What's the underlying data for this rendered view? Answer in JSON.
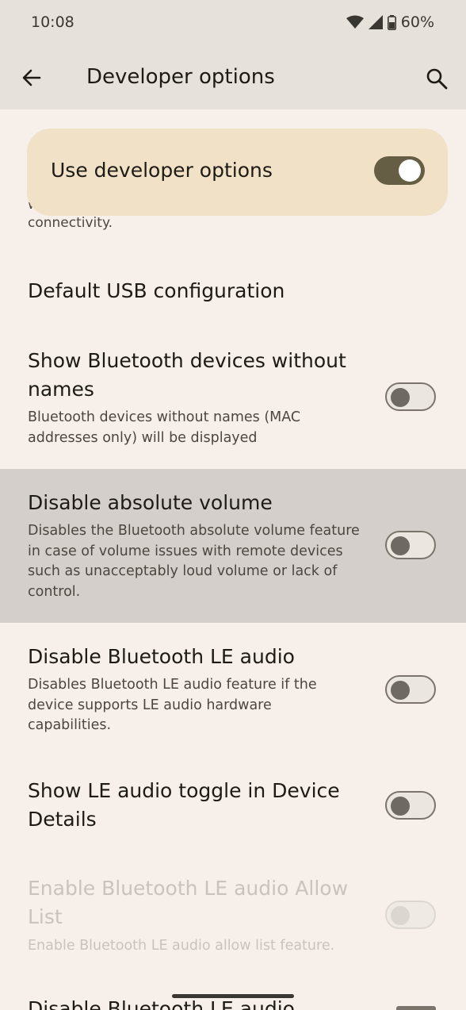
{
  "status": {
    "time": "10:08",
    "battery": "60%"
  },
  "app_bar": {
    "title": "Developer options"
  },
  "master": {
    "label": "Use developer options",
    "enabled": true
  },
  "partial_above": {
    "line1": "w",
    "line2": "connectivity."
  },
  "settings": [
    {
      "title": "Default USB configuration"
    },
    {
      "title": "Show Bluetooth devices without names",
      "summary": "Bluetooth devices without names (MAC addresses only) will be displayed",
      "on": false
    },
    {
      "title": "Disable absolute volume",
      "summary": "Disables the Bluetooth absolute volume feature in case of volume issues with remote devices such as unacceptably loud volume or lack of control.",
      "on": false,
      "highlighted": true
    },
    {
      "title": "Disable Bluetooth LE audio",
      "summary": "Disables Bluetooth LE audio feature if the device supports LE audio hardware capabilities.",
      "on": false
    },
    {
      "title": "Show LE audio toggle in Device Details",
      "on": false
    },
    {
      "title": "Enable Bluetooth LE audio Allow List",
      "summary": "Enable Bluetooth LE audio allow list feature.",
      "on": false,
      "disabled": true
    },
    {
      "title": "Disable Bluetooth LE audio"
    }
  ],
  "colors": {
    "background": "#f6efea",
    "appbar": "#e7e1dc",
    "master_card": "#f1e2c7",
    "switch_on": "#655e45",
    "highlight": "#d4cfca"
  }
}
